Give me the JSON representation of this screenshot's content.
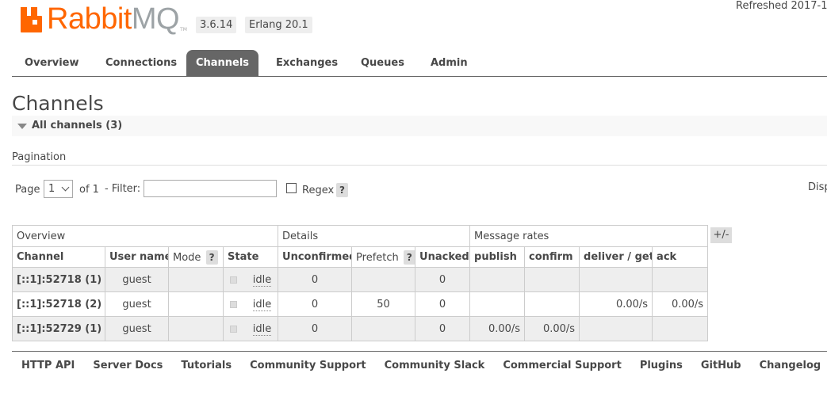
{
  "header": {
    "logo_rabbit": "Rabbit",
    "logo_mq": "MQ",
    "logo_tm": "TM",
    "version_badge": "3.6.14",
    "erlang_badge": "Erlang 20.1",
    "refreshed": "Refreshed 2017-1"
  },
  "tabs": [
    "Overview",
    "Connections",
    "Channels",
    "Exchanges",
    "Queues",
    "Admin"
  ],
  "active_tab": "Channels",
  "page": {
    "title": "Channels",
    "section_label": "All channels (3)"
  },
  "pagination": {
    "title": "Pagination",
    "page_label": "Page",
    "page_value": "1",
    "of_label": "of 1",
    "filter_label": "- Filter:",
    "filter_value": "",
    "regex_label": "Regex",
    "help_mark": "?",
    "display_label": "Disp"
  },
  "table": {
    "group_headers": [
      "Overview",
      "Details",
      "Message rates"
    ],
    "columns": [
      "Channel",
      "User name",
      "Mode",
      "State",
      "Unconfirmed",
      "Prefetch",
      "Unacked",
      "publish",
      "confirm",
      "deliver / get",
      "ack"
    ],
    "help_mark": "?",
    "toggle_label": "+/-",
    "rows": [
      {
        "channel": "[::1]:52718 (1)",
        "user": "guest",
        "mode": "",
        "state": "idle",
        "unconfirmed": "0",
        "prefetch": "",
        "unacked": "0",
        "publish": "",
        "confirm": "",
        "deliver_get": "",
        "ack": ""
      },
      {
        "channel": "[::1]:52718 (2)",
        "user": "guest",
        "mode": "",
        "state": "idle",
        "unconfirmed": "0",
        "prefetch": "50",
        "unacked": "0",
        "publish": "",
        "confirm": "",
        "deliver_get": "0.00/s",
        "ack": "0.00/s"
      },
      {
        "channel": "[::1]:52729 (1)",
        "user": "guest",
        "mode": "",
        "state": "idle",
        "unconfirmed": "0",
        "prefetch": "",
        "unacked": "0",
        "publish": "0.00/s",
        "confirm": "0.00/s",
        "deliver_get": "",
        "ack": ""
      }
    ]
  },
  "footer": [
    "HTTP API",
    "Server Docs",
    "Tutorials",
    "Community Support",
    "Community Slack",
    "Commercial Support",
    "Plugins",
    "GitHub",
    "Changelog"
  ],
  "colors": {
    "brand_orange": "#ff6600",
    "logo_grey": "#9da3a6",
    "active_tab_bg": "#666666",
    "row_alt_bg": "#eeeeee"
  }
}
